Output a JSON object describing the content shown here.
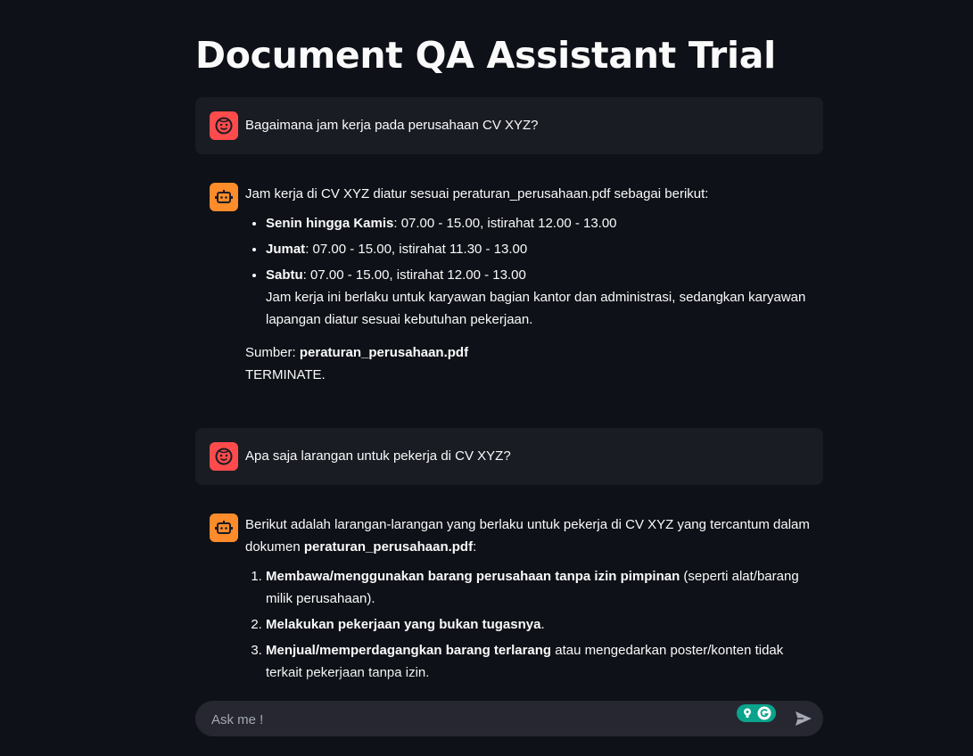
{
  "page": {
    "title": "Document QA Assistant Trial"
  },
  "messages": [
    {
      "role": "user",
      "text": "Bagaimana jam kerja pada perusahaan CV XYZ?"
    },
    {
      "role": "assistant",
      "intro": "Jam kerja di CV XYZ diatur sesuai peraturan_perusahaan.pdf sebagai berikut:",
      "items": [
        {
          "label": "Senin hingga Kamis",
          "text": ": 07.00 - 15.00, istirahat 12.00 - 13.00"
        },
        {
          "label": "Jumat",
          "text": ": 07.00 - 15.00, istirahat 11.30 - 13.00"
        },
        {
          "label": "Sabtu",
          "text": ": 07.00 - 15.00, istirahat 12.00 - 13.00",
          "extra": "Jam kerja ini berlaku untuk karyawan bagian kantor dan administrasi, sedangkan karyawan lapangan diatur sesuai kebutuhan pekerjaan."
        }
      ],
      "source_label": "Sumber: ",
      "source_file": "peraturan_perusahaan.pdf",
      "terminate": "TERMINATE."
    },
    {
      "role": "user",
      "text": "Apa saja larangan untuk pekerja di CV XYZ?"
    },
    {
      "role": "assistant",
      "intro": "Berikut adalah larangan-larangan yang berlaku untuk pekerja di CV XYZ yang tercantum dalam dokumen ",
      "intro_bold": "peraturan_perusahaan.pdf",
      "intro_end": ":",
      "items": [
        {
          "label": "Membawa/menggunakan barang perusahaan tanpa izin pimpinan",
          "text": " (seperti alat/barang milik perusahaan)."
        },
        {
          "label": "Melakukan pekerjaan yang bukan tugasnya",
          "text": "."
        },
        {
          "label": "Menjual/memperdagangkan barang terlarang",
          "text": " atau mengedarkan poster/konten tidak terkait pekerjaan tanpa izin."
        }
      ]
    }
  ],
  "chat_input": {
    "placeholder": "Ask me !"
  },
  "colors": {
    "background": "#0e1117",
    "user_avatar": "#ff4b4b",
    "bot_avatar": "#ff8c2b",
    "user_bubble": "#1a1c24",
    "input_bg": "#262730"
  },
  "icons": {
    "user_avatar": "smiley-face-icon",
    "bot_avatar": "robot-icon",
    "send": "send-arrow-icon",
    "grammarly": "grammarly-icon"
  }
}
